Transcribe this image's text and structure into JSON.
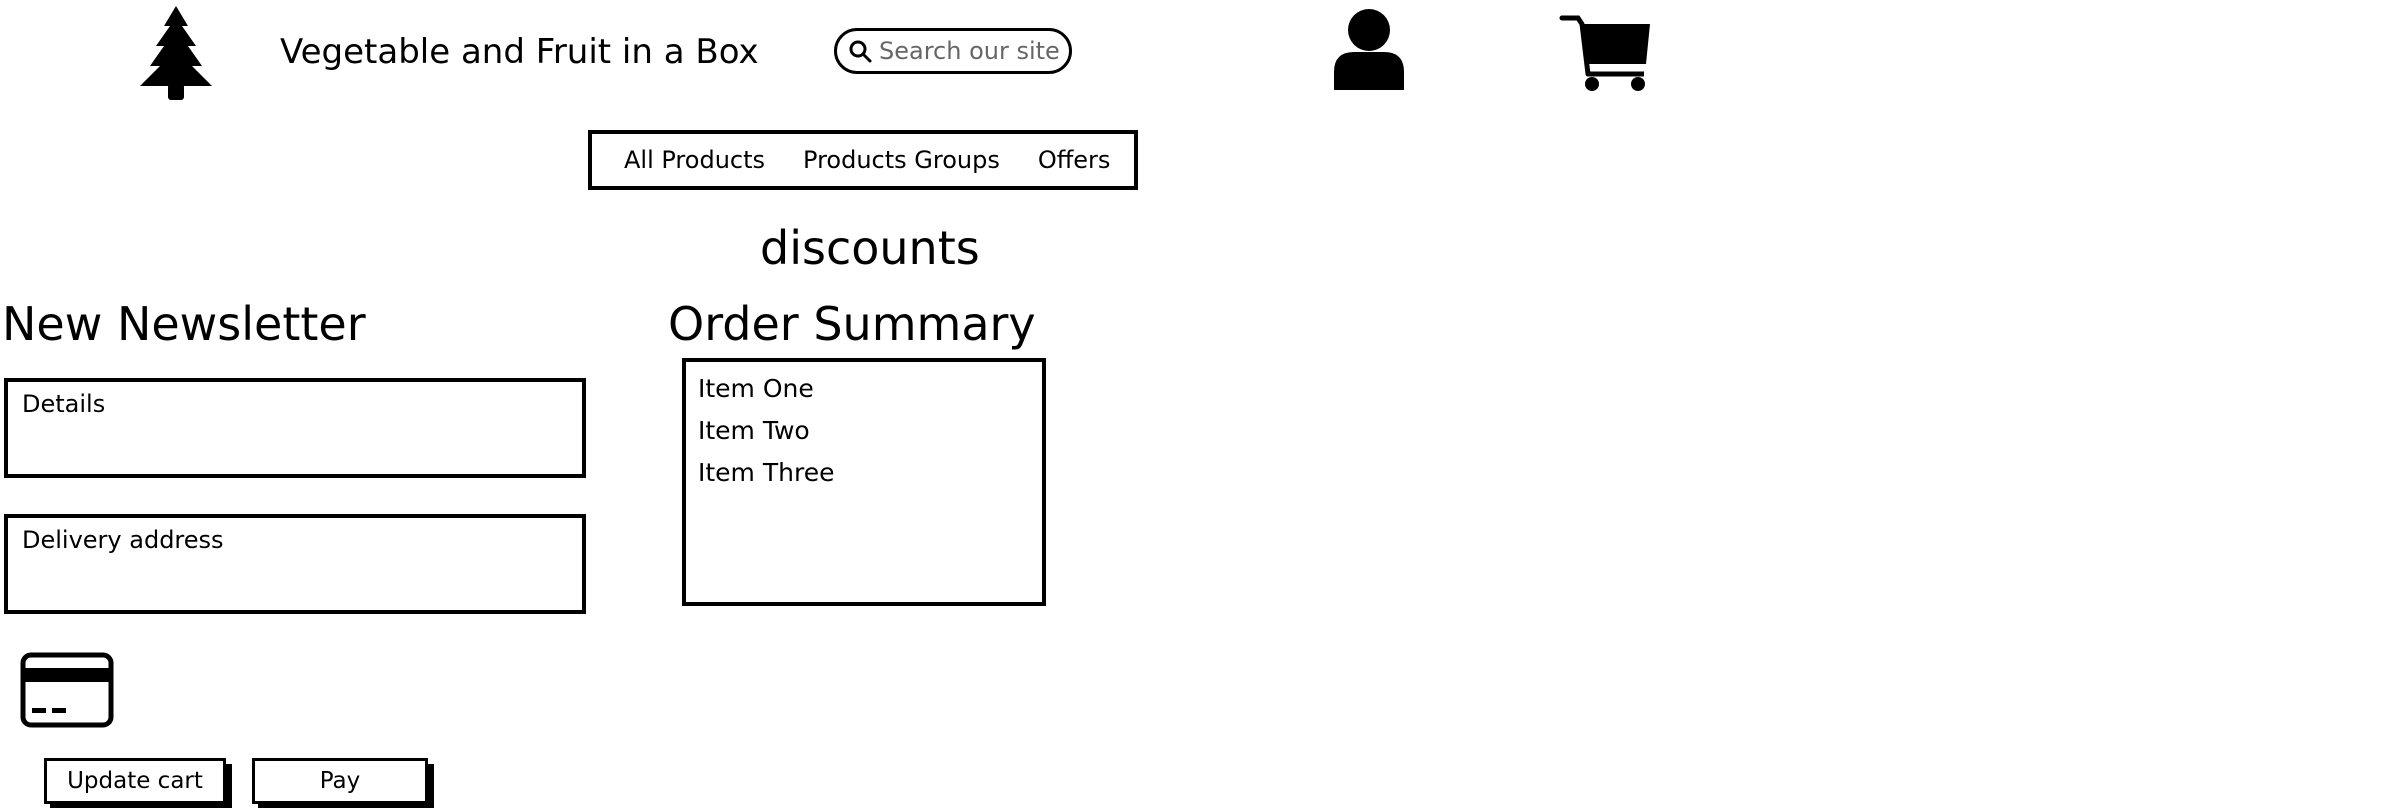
{
  "header": {
    "logo_icon": "tree-icon",
    "title": "Vegetable and Fruit in a Box",
    "search": {
      "placeholder": "Search our site",
      "value": ""
    },
    "user_icon": "user-icon",
    "cart_icon": "cart-icon"
  },
  "nav": {
    "items": [
      {
        "label": "All Products"
      },
      {
        "label": "Products Groups"
      },
      {
        "label": "Offers"
      }
    ]
  },
  "banner": {
    "text": "discounts"
  },
  "newsletter": {
    "heading": "New Newsletter",
    "details_label": "Details",
    "delivery_label": "Delivery address",
    "card_icon": "credit-card-icon"
  },
  "buttons": {
    "update_cart": "Update cart",
    "pay": "Pay"
  },
  "order_summary": {
    "heading": "Order Summary",
    "items": [
      "Item One",
      "Item Two",
      "Item Three"
    ]
  },
  "colors": {
    "ink": "#000000",
    "background": "#ffffff",
    "placeholder": "#666666"
  }
}
